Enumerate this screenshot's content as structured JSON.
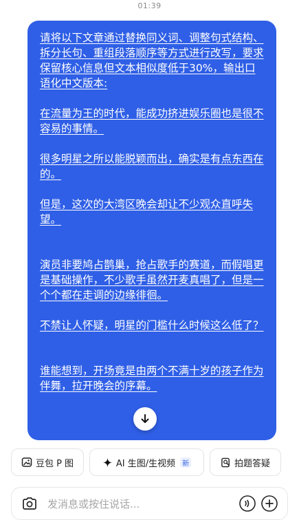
{
  "status_bar": {
    "time": "01:39"
  },
  "message": {
    "paragraphs": [
      "请将以下文章通过替换同义词、调整句式结构、拆分长句、重组段落顺序等方式进行改写，要求保留核心信息但文本相似度低于30%，输出口语化中文版本:",
      "在流量为王的时代，能成功挤进娱乐圈也是很不容易的事情。",
      "很多明星之所以能脱颖而出，确实是有点东西在的。",
      "但是，这次的大湾区晚会却让不少观众直呼失望。",
      "演员非要鸠占鹊巢，抢占歌手的赛道，而假唱更是基础操作，不少歌手虽然开麦真唱了，但是一个个都在走调的边缘徘徊。",
      "不禁让人怀疑，明星的门槛什么时候这么低了？",
      "谁能想到，开场竟是由两个不满十岁的孩子作为伴舞，拉开晚会的序幕。"
    ]
  },
  "actions": [
    {
      "label": "豆包 P 图",
      "icon": "image-edit-icon"
    },
    {
      "label": "AI 生图/生视频",
      "icon": "sparkle-icon",
      "badge": "新"
    },
    {
      "label": "拍题答疑",
      "icon": "question-scan-icon"
    }
  ],
  "input": {
    "placeholder": "发消息或按住说话..."
  },
  "colors": {
    "bubble": "#2f5fe6",
    "accent": "#3a66e0"
  }
}
